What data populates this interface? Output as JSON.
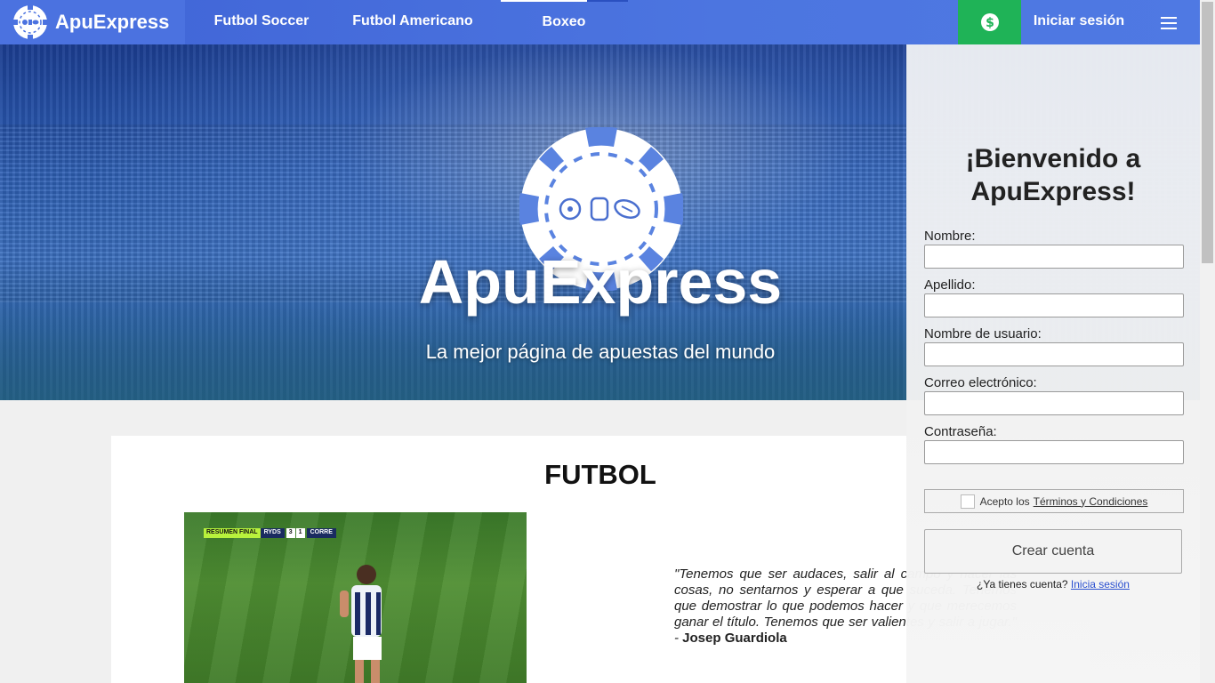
{
  "nav": {
    "brand": "ApuExpress",
    "links": [
      "Futbol Soccer",
      "Futbol Americano",
      "Boxeo"
    ],
    "login": "Iniciar sesión"
  },
  "hero": {
    "title": "ApuExpress",
    "subtitle": "La mejor página de apuestas del mundo"
  },
  "content": {
    "section_title": "FUTBOL",
    "video_scoreboard": {
      "label": "RESUMEN FINAL",
      "home": "RYDS",
      "home_score": "3",
      "away_score": "1",
      "away": "CORRE"
    },
    "quote": "\"Tenemos que ser audaces, salir al campo y hacer las cosas, no sentarnos y esperar a que suceda. Tenemos que demostrar lo que podemos hacer y que merecemos ganar el título. Tenemos que ser valientes y salir a jugar.\" - ",
    "quote_author": "Josep Guardiola"
  },
  "signup": {
    "title": "¡Bienvenido a ApuExpress!",
    "fields": [
      {
        "label": "Nombre:",
        "value": ""
      },
      {
        "label": "Apellido:",
        "value": ""
      },
      {
        "label": "Nombre de usuario:",
        "value": ""
      },
      {
        "label": "Correo electrónico:",
        "value": ""
      },
      {
        "label": "Contraseña:",
        "value": ""
      }
    ],
    "terms_prefix": "Acepto los",
    "terms_link": "Términos y Condiciones",
    "terms_checked": false,
    "create_button": "Crear cuenta",
    "have_account": "¿Ya tienes cuenta?",
    "login_link": "Inicia sesión"
  },
  "colors": {
    "nav": "#4b72e0",
    "money": "#1fb357"
  }
}
